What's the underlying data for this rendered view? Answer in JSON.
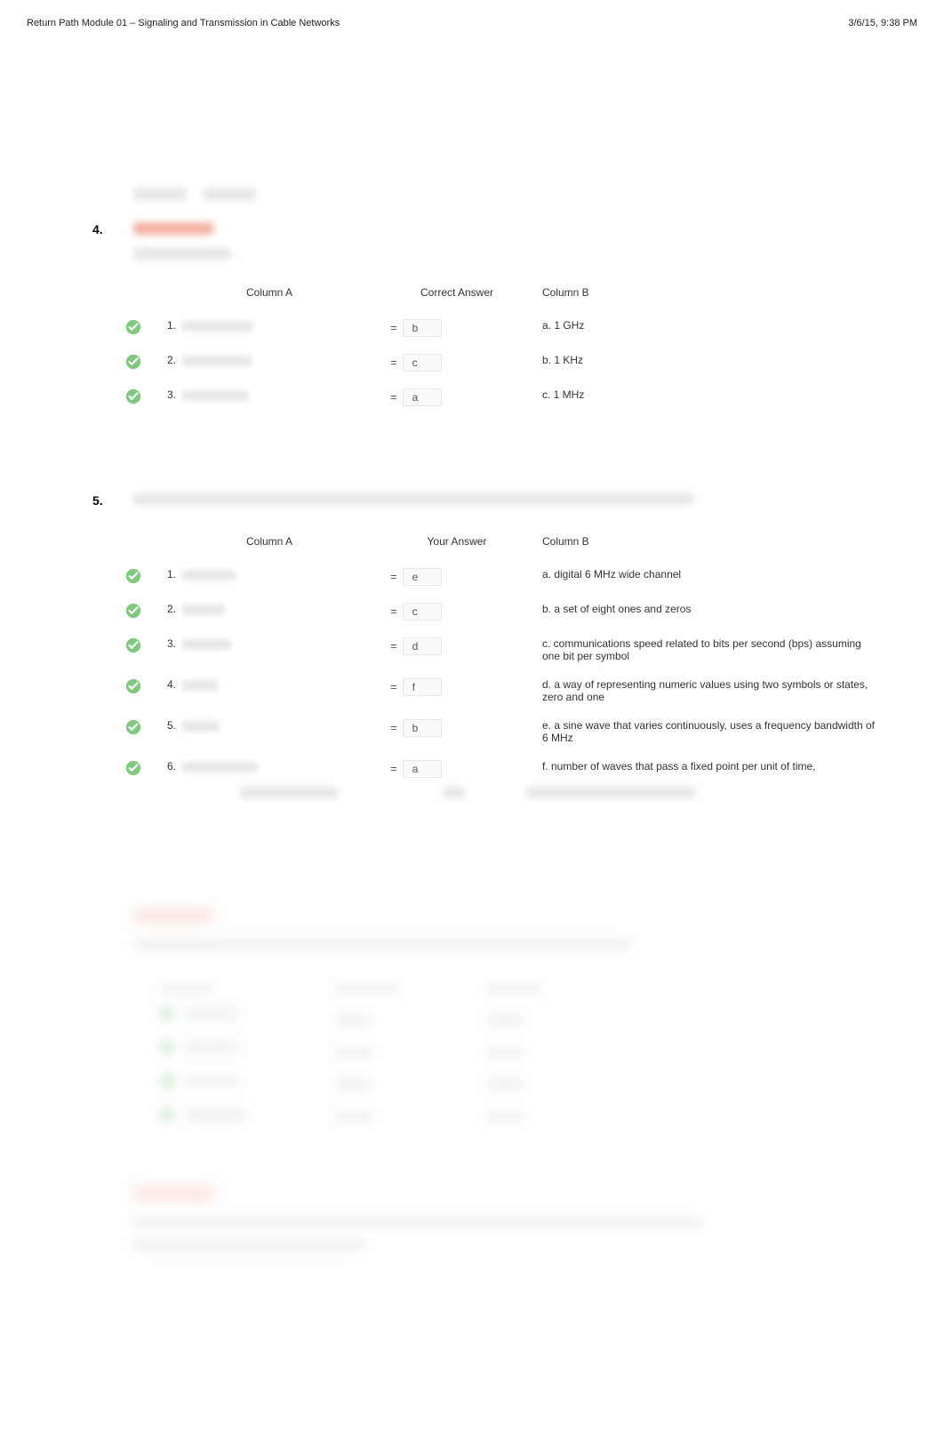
{
  "header": {
    "left": "Return Path Module 01 – Signaling and Transmission in Cable Networks",
    "right": "3/6/15, 9:38 PM"
  },
  "q4": {
    "number": "4.",
    "head": {
      "colA": "Column A",
      "ans": "Correct Answer",
      "colB": "Column B"
    },
    "rows": [
      {
        "n": "1.",
        "ans": "b",
        "b": "a. 1 GHz"
      },
      {
        "n": "2.",
        "ans": "c",
        "b": "b. 1 KHz"
      },
      {
        "n": "3.",
        "ans": "a",
        "b": "c. 1 MHz"
      }
    ]
  },
  "q5": {
    "number": "5.",
    "head": {
      "colA": "Column A",
      "ans": "Your Answer",
      "colB": "Column B"
    },
    "rows": [
      {
        "n": "1.",
        "ans": "e",
        "b": "a. digital 6 MHz wide channel"
      },
      {
        "n": "2.",
        "ans": "c",
        "b": "b. a set of eight ones and zeros"
      },
      {
        "n": "3.",
        "ans": "d",
        "b": "c. communications speed related to bits per second (bps) assuming one bit per symbol"
      },
      {
        "n": "4.",
        "ans": "f",
        "b": "d. a way of representing numeric values using two symbols or states, zero and one"
      },
      {
        "n": "5.",
        "ans": "b",
        "b": "e. a sine wave that varies continuously, uses a frequency bandwidth of 6 MHz"
      },
      {
        "n": "6.",
        "ans": "a",
        "b": "f. number of waves that pass a fixed point per unit of time,"
      }
    ]
  }
}
